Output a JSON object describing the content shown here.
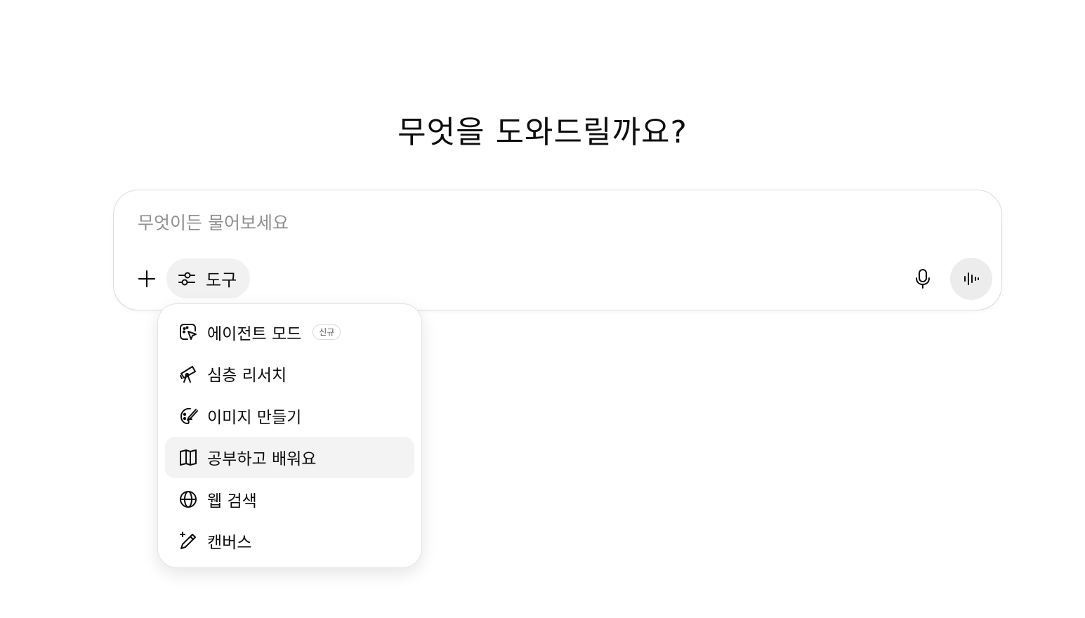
{
  "headline": "무엇을 도와드릴까요?",
  "composer": {
    "placeholder": "무엇이든 물어보세요",
    "value": "",
    "tools_label": "도구"
  },
  "icons": {
    "plus": "plus-icon",
    "tools": "sliders-icon",
    "mic": "microphone-icon",
    "voice": "voice-waveform-icon"
  },
  "menu": {
    "items": [
      {
        "label": "에이전트 모드",
        "icon": "agent-cursor-icon",
        "badge": "신규"
      },
      {
        "label": "심층 리서치",
        "icon": "telescope-icon"
      },
      {
        "label": "이미지 만들기",
        "icon": "palette-icon"
      },
      {
        "label": "공부하고 배워요",
        "icon": "book-icon",
        "highlighted": true
      },
      {
        "label": "웹 검색",
        "icon": "globe-icon"
      },
      {
        "label": "캔버스",
        "icon": "pencil-sparkle-icon"
      }
    ]
  },
  "colors": {
    "text": "#0d0d0d",
    "placeholder": "#8f8f8f",
    "pill_background": "#f1f1f1",
    "highlight_background": "#f3f3f3"
  }
}
